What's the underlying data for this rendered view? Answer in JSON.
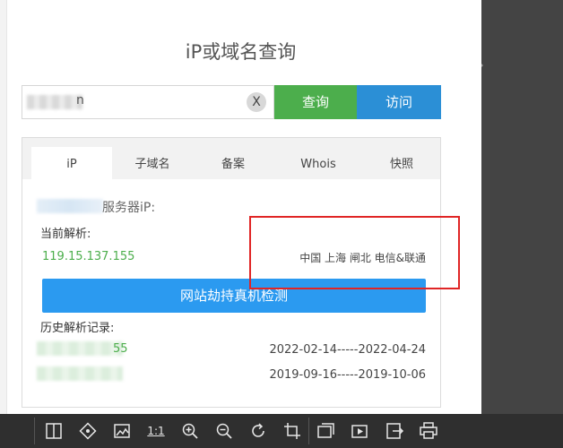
{
  "title": "iP或域名查询",
  "search": {
    "query_tail": "n",
    "clear_label": "X",
    "query_button": "查询",
    "visit_button": "访问"
  },
  "tabs": [
    {
      "label": "iP",
      "active": true
    },
    {
      "label": "子域名",
      "active": false
    },
    {
      "label": "备案",
      "active": false
    },
    {
      "label": "Whois",
      "active": false
    },
    {
      "label": "快照",
      "active": false
    }
  ],
  "result": {
    "server_label": "服务器iP:",
    "current_label": "当前解析:",
    "current_ip": "119.15.137.155",
    "current_location": "中国 上海 闸北 电信&联通",
    "hijack_button": "网站劫持真机检测",
    "history_label": "历史解析记录:",
    "history": [
      {
        "ip_tail": "55",
        "range": "2022-02-14-----2022-04-24"
      },
      {
        "ip_tail": "",
        "range": "2019-09-16-----2019-10-06"
      }
    ]
  },
  "toolbar": {
    "icons": [
      "fit-width-icon",
      "rotate-select-icon",
      "image-edit-icon",
      "actual-size-icon",
      "zoom-in-icon",
      "zoom-out-icon",
      "rotate-icon",
      "crop-icon",
      "gallery-icon",
      "slideshow-icon",
      "export-icon",
      "print-icon"
    ],
    "actual_size_label": "1:1"
  },
  "colors": {
    "green": "#4cae4c",
    "blue": "#2b8fd6",
    "highlight": "#e02525"
  }
}
